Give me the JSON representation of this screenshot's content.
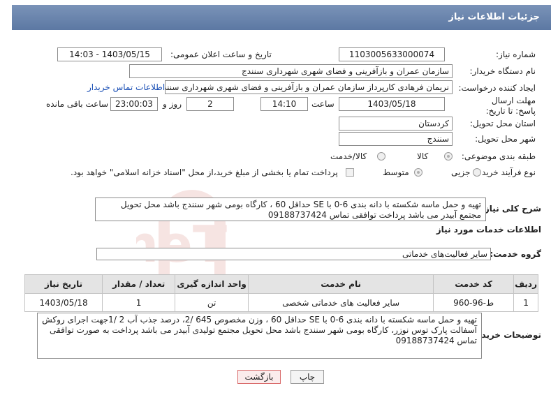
{
  "header": {
    "title": "جزئیات اطلاعات نیاز"
  },
  "fields": {
    "need_number_label": "شماره نیاز:",
    "need_number": "1103005633000074",
    "announce_label": "تاریخ و ساعت اعلان عمومی:",
    "announce_value": "1403/05/15 - 14:03",
    "buyer_org_label": "نام دستگاه خریدار:",
    "buyer_org": "سازمان عمران و بازآفرینی و فضای شهری شهرداری سنندج",
    "requester_label": "ایجاد کننده درخواست:",
    "requester": "نریمان فرهادی کارپرداز سازمان عمران و بازآفرینی و فضای شهری شهرداری سنندج",
    "contact_link": "اطلاعات تماس خریدار",
    "deadline_label": "مهلت ارسال پاسخ: تا تاریخ:",
    "deadline_date": "1403/05/18",
    "time_label": "ساعت",
    "deadline_time": "14:10",
    "days_value": "2",
    "days_label": "روز و",
    "remaining_time": "23:00:03",
    "remaining_label": "ساعت باقی مانده",
    "province_label": "استان محل تحویل:",
    "province": "کردستان",
    "city_label": "شهر محل تحویل:",
    "city": "سنندج",
    "category_label": "طبقه بندی موضوعی:",
    "category_options": [
      "کالا",
      "کالا/خدمت"
    ],
    "process_label": "نوع فرآیند خرید :",
    "process_options": [
      "جزیی",
      "متوسط"
    ],
    "payment_note": "پرداخت تمام یا بخشی از مبلغ خرید،از محل \"اسناد خزانه اسلامی\" خواهد بود."
  },
  "summary": {
    "label": "شرح کلی نیاز:",
    "text": "تهیه و حمل ماسه شکسته با دانه بندی  6-0  با SE  حداقل 60 ، کارگاه بومی شهر سنندج باشد محل تحویل مجتمع آبیدر می باشد پرداخت توافقی تماس 09188737424"
  },
  "services": {
    "section_title": "اطلاعات خدمات مورد نیاز",
    "group_label": "گروه خدمت:",
    "group_value": "سایر فعالیت‌های خدماتی",
    "columns": [
      "ردیف",
      "کد خدمت",
      "نام خدمت",
      "واحد اندازه گیری",
      "تعداد / مقدار",
      "تاریخ نیاز"
    ],
    "rows": [
      [
        "1",
        "ط-96-960",
        "سایر فعالیت های خدماتی شخصی",
        "تن",
        "1",
        "1403/05/18"
      ]
    ]
  },
  "buyer_notes": {
    "label": "توضیحات خریدار:",
    "text": "تهیه و حمل ماسه شکسته با دانه بندی  6-0  با SE  حداقل 60 ،  وزن مخصوص 645 /2، درصد جذب آب 2 /1جهت اجرای روکش آسفالت پارک توس نوزر، کارگاه بومی شهر سنندج باشد محل تحویل مجتمع تولیدی آبیدر می باشد پرداخت به صورت توافقی تماس 09188737424"
  },
  "buttons": {
    "print": "چاپ",
    "back": "بازگشت"
  },
  "watermark_text": "AriaTender.neT",
  "colors": {
    "header": "#6b84ac",
    "link": "#1a4fb5",
    "watermark": "#c0392b"
  }
}
